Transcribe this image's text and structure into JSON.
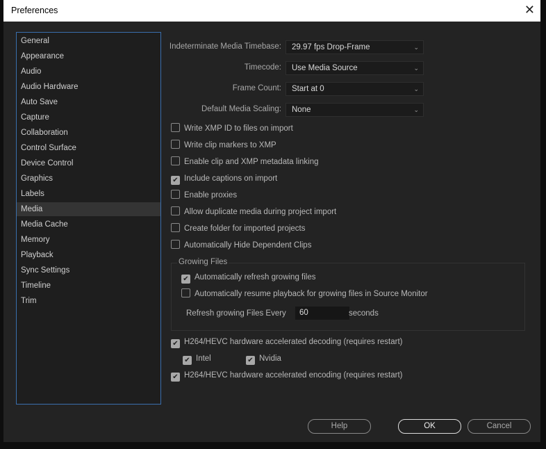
{
  "window": {
    "title": "Preferences",
    "close_icon": "close-icon"
  },
  "sidebar": {
    "items": [
      "General",
      "Appearance",
      "Audio",
      "Audio Hardware",
      "Auto Save",
      "Capture",
      "Collaboration",
      "Control Surface",
      "Device Control",
      "Graphics",
      "Labels",
      "Media",
      "Media Cache",
      "Memory",
      "Playback",
      "Sync Settings",
      "Timeline",
      "Trim"
    ],
    "selected": "Media"
  },
  "fields": [
    {
      "label": "Indeterminate Media Timebase:",
      "value": "29.97 fps Drop-Frame"
    },
    {
      "label": "Timecode:",
      "value": "Use Media Source"
    },
    {
      "label": "Frame Count:",
      "value": "Start at 0"
    },
    {
      "label": "Default Media Scaling:",
      "value": "None"
    }
  ],
  "checkboxes": [
    {
      "label": "Write XMP ID to files on import",
      "checked": false
    },
    {
      "label": "Write clip markers to XMP",
      "checked": false
    },
    {
      "label": "Enable clip and XMP metadata linking",
      "checked": false
    },
    {
      "label": "Include captions on import",
      "checked": true
    },
    {
      "label": "Enable proxies",
      "checked": false
    },
    {
      "label": "Allow duplicate media during project import",
      "checked": false
    },
    {
      "label": "Create folder for imported projects",
      "checked": false
    },
    {
      "label": "Automatically Hide Dependent Clips",
      "checked": false
    }
  ],
  "growing": {
    "title": "Growing Files",
    "refresh": {
      "label": "Automatically refresh growing files",
      "checked": true
    },
    "resume": {
      "label": "Automatically resume playback for growing files in Source Monitor",
      "checked": false
    },
    "every_label": "Refresh growing Files Every",
    "every_value": "60",
    "unit": "seconds"
  },
  "hw": {
    "decoding": {
      "label": "H264/HEVC hardware accelerated decoding (requires restart)",
      "checked": true
    },
    "intel": {
      "label": "Intel",
      "checked": true
    },
    "nvidia": {
      "label": "Nvidia",
      "checked": true
    },
    "encoding": {
      "label": "H264/HEVC hardware accelerated encoding (requires restart)",
      "checked": true
    }
  },
  "buttons": {
    "help": "Help",
    "ok": "OK",
    "cancel": "Cancel"
  },
  "colors": {
    "accent": "#3a6fae",
    "dialog_bg": "#232323"
  }
}
